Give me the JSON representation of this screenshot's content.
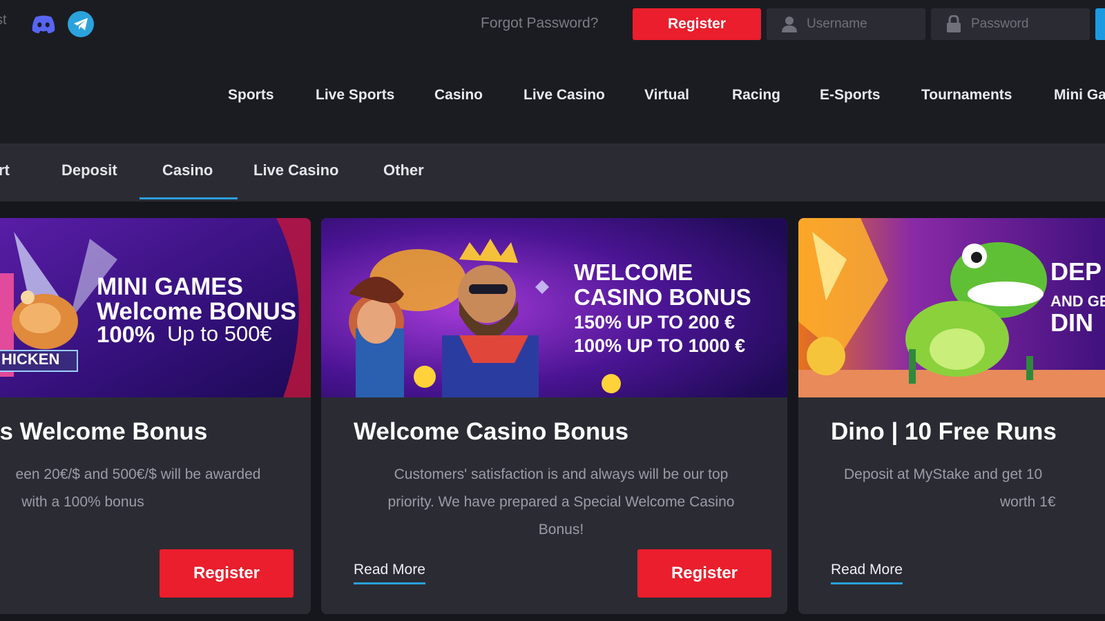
{
  "header": {
    "cut_text": "st",
    "forgot_password": "Forgot Password?",
    "register_label": "Register",
    "username_placeholder": "Username",
    "password_placeholder": "Password",
    "social_icons": [
      "discord-icon",
      "telegram-icon"
    ]
  },
  "main_nav": {
    "items": [
      "Sports",
      "Live Sports",
      "Casino",
      "Live Casino",
      "Virtual",
      "Racing",
      "E-Sports",
      "Tournaments",
      "Mini Ga"
    ]
  },
  "sub_nav": {
    "items": [
      "rt",
      "Deposit",
      "Casino",
      "Live Casino",
      "Other"
    ],
    "active": "Casino"
  },
  "cards": [
    {
      "banner_lines": [
        "MINI GAMES",
        "Welcome BONUS",
        "100%",
        "Up to 500€"
      ],
      "banner_badge": "HICKEN",
      "title": "es Welcome Bonus",
      "desc_lines": [
        "een 20€/$ and 500€/$ will be awarded",
        "with a 100% bonus"
      ],
      "register_label": "Register"
    },
    {
      "banner_lines": [
        "WELCOME",
        "CASINO BONUS",
        "150% UP TO 200 €",
        "100% UP TO 1000 €"
      ],
      "title": "Welcome Casino Bonus",
      "desc_lines": [
        "Customers' satisfaction is and always will be our top",
        "priority. We have prepared a Special Welcome Casino",
        "Bonus!"
      ],
      "read_more_label": "Read More",
      "register_label": "Register"
    },
    {
      "banner_lines": [
        "DEP",
        "AND GE",
        "DIN"
      ],
      "title": "Dino | 10 Free Runs",
      "desc_lines": [
        "Deposit at MyStake and get 10",
        "worth 1€"
      ],
      "read_more_label": "Read More"
    }
  ],
  "colors": {
    "accent_red": "#ea1e2c",
    "accent_blue": "#2aa0dc",
    "background": "#16171d",
    "panel": "#2b2c33"
  }
}
